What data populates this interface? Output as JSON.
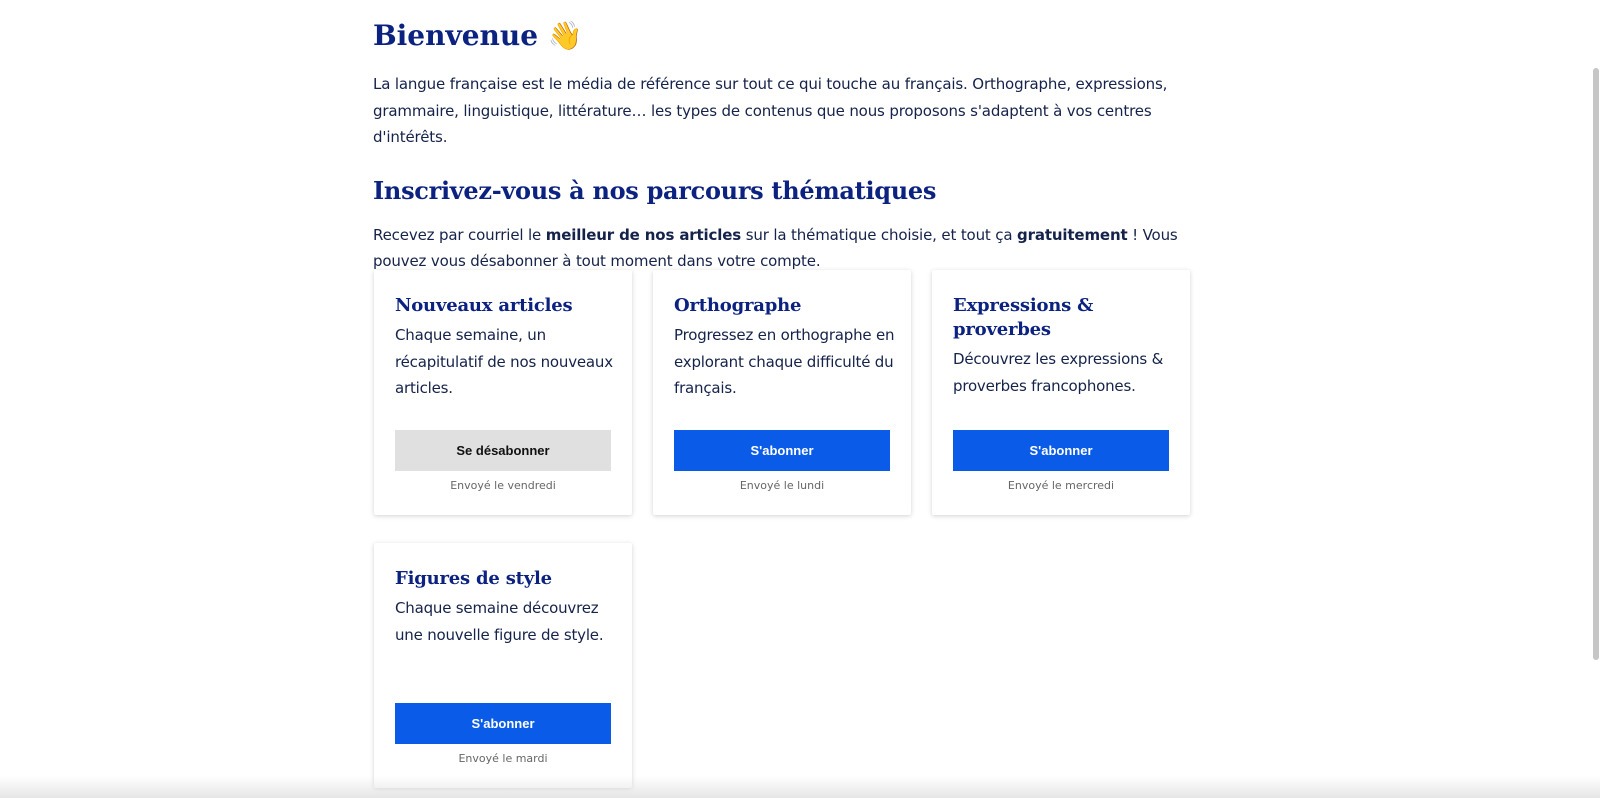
{
  "header": {
    "welcome_title": "Bienvenue 👋",
    "intro": "La langue française est le média de référence sur tout ce qui touche au français. Orthographe, expressions, grammaire, linguistique, littérature… les types de contenus que nous proposons s'adaptent à vos centres d'intérêts."
  },
  "subscriptions": {
    "title": "Inscrivez-vous à nos parcours thématiques",
    "text_before": "Recevez par courriel le ",
    "text_bold1": "meilleur de nos articles",
    "text_middle": " sur la thématique choisie, et tout ça ",
    "text_bold2": "gratuitement",
    "text_after": " ! Vous pouvez vous désabonner à tout moment dans votre compte."
  },
  "cards": [
    {
      "title": "Nouveaux articles",
      "description": "Chaque semaine, un récapitulatif de nos nouveaux articles.",
      "button_label": "Se désabonner",
      "note": "Envoyé le vendredi"
    },
    {
      "title": "Orthographe",
      "description": "Progressez en orthographe en explorant chaque difficulté du français.",
      "button_label": "S'abonner",
      "note": "Envoyé le lundi"
    },
    {
      "title": "Expressions & proverbes",
      "description": "Découvrez les expressions & proverbes francophones.",
      "button_label": "S'abonner",
      "note": "Envoyé le mercredi"
    },
    {
      "title": "Figures de style",
      "description": "Chaque semaine découvrez une nouvelle figure de style.",
      "button_label": "S'abonner",
      "note": "Envoyé le mardi"
    }
  ],
  "colors": {
    "heading": "#0c2280",
    "text": "#15224a",
    "primary_button": "#0a5ce8",
    "secondary_button": "#e0e0e0"
  }
}
